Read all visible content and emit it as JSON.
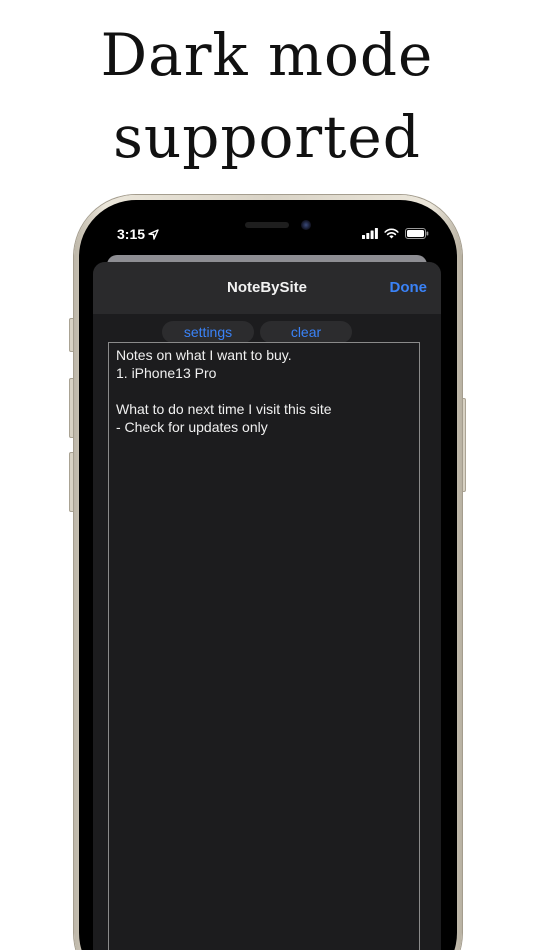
{
  "headline": {
    "line1": "Dark mode",
    "line2": "supported"
  },
  "status_bar": {
    "time": "3:15",
    "icons": [
      "location-arrow-icon",
      "cellular-signal-icon",
      "wifi-icon",
      "battery-icon"
    ]
  },
  "nav": {
    "title": "NoteBySite",
    "done_label": "Done"
  },
  "toolbar": {
    "settings_label": "settings",
    "clear_label": "clear"
  },
  "note": {
    "text": "Notes on what I want to buy.\n1. iPhone13 Pro\n\nWhat to do next time I visit this site\n- Check for updates only"
  },
  "colors": {
    "accent": "#3a82f7",
    "sheet_bg": "#1c1c1e",
    "nav_bg": "#2a2a2c",
    "text": "#f0f0f0"
  }
}
